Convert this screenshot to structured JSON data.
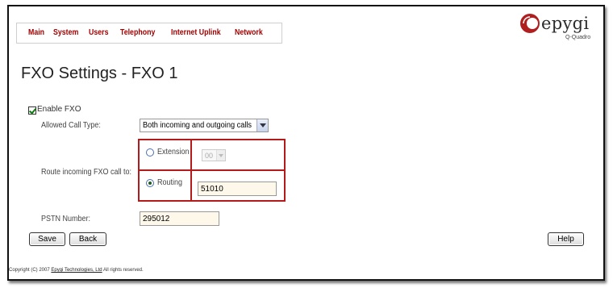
{
  "nav": {
    "items": [
      "Main",
      "System",
      "Users",
      "Telephony",
      "Internet Uplink",
      "Network"
    ]
  },
  "logo": {
    "text": "epygi",
    "subtitle": "Q-Quadro",
    "accent_color": "#b01f1f"
  },
  "page": {
    "title": "FXO Settings - FXO 1"
  },
  "form": {
    "enable_fxo_label": "Enable FXO",
    "enable_fxo_checked": true,
    "allowed_call_type_label": "Allowed Call Type:",
    "allowed_call_type_value": "Both incoming and outgoing calls",
    "route_label": "Route incoming FXO call to:",
    "extension_label": "Extension",
    "extension_value": "00",
    "routing_label": "Routing",
    "routing_value": "51010",
    "selected_route": "Routing",
    "pstn_label": "PSTN Number:",
    "pstn_value": "295012"
  },
  "buttons": {
    "save": "Save",
    "back": "Back",
    "help": "Help"
  },
  "footer": {
    "prefix": "Copyright (C) 2007",
    "company": "Epygi Technologies, Ltd",
    "suffix": "All rights reserved."
  }
}
